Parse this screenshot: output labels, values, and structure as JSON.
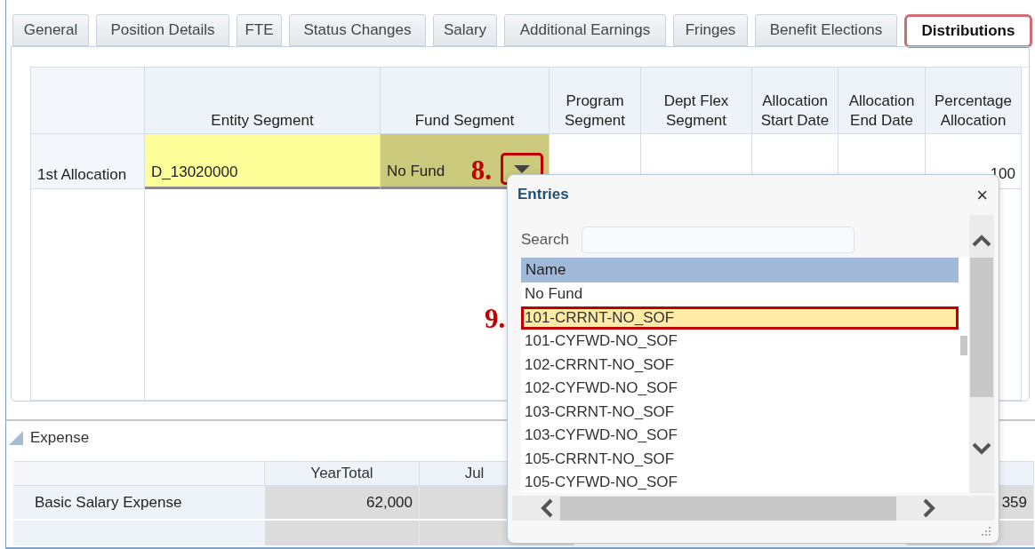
{
  "tabs": [
    {
      "label": "General",
      "selected": false
    },
    {
      "label": "Position Details",
      "selected": false
    },
    {
      "label": "FTE",
      "selected": false
    },
    {
      "label": "Status Changes",
      "selected": false
    },
    {
      "label": "Salary",
      "selected": false
    },
    {
      "label": "Additional Earnings",
      "selected": false
    },
    {
      "label": "Fringes",
      "selected": false
    },
    {
      "label": "Benefit Elections",
      "selected": false
    },
    {
      "label": "Distributions",
      "selected": true
    }
  ],
  "allocation_table": {
    "columns": [
      "Entity Segment",
      "Fund Segment",
      "Program Segment",
      "Dept Flex Segment",
      "Allocation Start Date",
      "Allocation End Date",
      "Percentage Allocation"
    ],
    "rows": [
      {
        "label": "1st Allocation",
        "cells": [
          {
            "kind": "input",
            "value": "D_13020000"
          },
          {
            "kind": "dropdown",
            "value": "No Fund"
          },
          {
            "kind": "blank"
          },
          {
            "kind": "blank"
          },
          {
            "kind": "blank"
          },
          {
            "kind": "blank"
          },
          {
            "kind": "number",
            "value": "100"
          }
        ]
      }
    ]
  },
  "expense": {
    "title": "Expense",
    "columns": [
      "YearTotal",
      "Jul"
    ],
    "rows": [
      {
        "label": "Basic Salary Expense",
        "year_total": "62,000",
        "last_column": "359"
      }
    ]
  },
  "entries_popup": {
    "title": "Entries",
    "close": "×",
    "search_label": "Search",
    "list_header": "Name",
    "items": [
      {
        "label": "No Fund",
        "selected": false
      },
      {
        "label": "101-CRRNT-NO_SOF",
        "selected": true
      },
      {
        "label": "101-CYFWD-NO_SOF",
        "selected": false
      },
      {
        "label": "102-CRRNT-NO_SOF",
        "selected": false
      },
      {
        "label": "102-CYFWD-NO_SOF",
        "selected": false
      },
      {
        "label": "103-CRRNT-NO_SOF",
        "selected": false
      },
      {
        "label": "103-CYFWD-NO_SOF",
        "selected": false
      },
      {
        "label": "105-CRRNT-NO_SOF",
        "selected": false
      },
      {
        "label": "105-CYFWD-NO_SOF",
        "selected": false
      }
    ]
  },
  "annotations": [
    "8.",
    "9."
  ]
}
